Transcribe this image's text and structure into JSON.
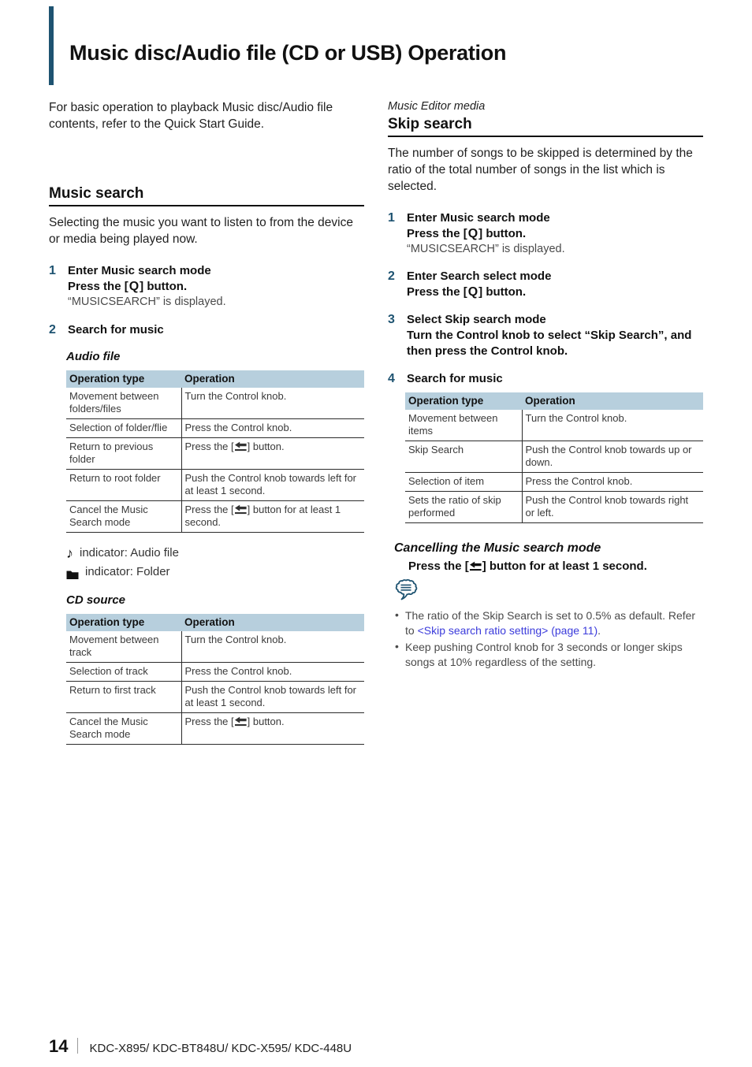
{
  "page": {
    "title": "Music disc/Audio file (CD or USB) Operation",
    "footer_page_number": "14",
    "footer_models": "KDC-X895/ KDC-BT848U/ KDC-X595/ KDC-448U"
  },
  "colors": {
    "accent_rule": "#1e5371",
    "step_number": "#1e5371",
    "table_header_bg": "#b7cfdd",
    "xref_link": "#3b3bdb"
  },
  "left_column": {
    "intro": "For basic operation to playback Music disc/Audio file contents, refer to the Quick Start Guide.",
    "section_heading": "Music search",
    "section_intro": "Selecting the music you want to listen to from the device or media being played now.",
    "steps": [
      {
        "number": "1",
        "title": "Enter Music search mode",
        "action_prefix": "Press the [",
        "action_key": "Q",
        "action_suffix": "] button.",
        "note": "“MUSICSEARCH” is displayed."
      },
      {
        "number": "2",
        "title": "Search for music"
      }
    ],
    "audio_file": {
      "heading": "Audio file",
      "columns": [
        "Operation type",
        "Operation"
      ],
      "rows": [
        [
          "Movement between folders/files",
          "Turn the Control knob."
        ],
        [
          "Selection of folder/flie",
          "Press the Control knob."
        ],
        [
          "Return to previous folder",
          "Press the [↩] button."
        ],
        [
          "Return to root folder",
          "Push the Control knob towards left for at least 1 second."
        ],
        [
          "Cancel the Music Search mode",
          "Press the [↩] button for at least 1 second."
        ]
      ],
      "rows_display": [
        {
          "type": "Movement between folders/files",
          "op_pre": "Turn the Control knob.",
          "op_icon": false,
          "op_post": ""
        },
        {
          "type": "Selection of folder/flie",
          "op_pre": "Press the Control knob.",
          "op_icon": false,
          "op_post": ""
        },
        {
          "type": "Return to previous folder",
          "op_pre": "Press the [",
          "op_icon": true,
          "op_post": "] button."
        },
        {
          "type": "Return to root folder",
          "op_pre": "Push the Control knob towards left for at least 1 second.",
          "op_icon": false,
          "op_post": ""
        },
        {
          "type": "Cancel the Music Search mode",
          "op_pre": "Press the [",
          "op_icon": true,
          "op_post": "] button for at least 1 second."
        }
      ]
    },
    "indicators": [
      {
        "icon": "music-note-icon",
        "label": "indicator: Audio file"
      },
      {
        "icon": "folder-icon",
        "label": "indicator: Folder"
      }
    ],
    "cd_source": {
      "heading": "CD source",
      "columns": [
        "Operation type",
        "Operation"
      ],
      "rows_display": [
        {
          "type": "Movement between track",
          "op_pre": "Turn the Control knob.",
          "op_icon": false,
          "op_post": ""
        },
        {
          "type": "Selection of track",
          "op_pre": "Press the Control knob.",
          "op_icon": false,
          "op_post": ""
        },
        {
          "type": "Return to first track",
          "op_pre": "Push the Control knob towards left for at least 1 second.",
          "op_icon": false,
          "op_post": ""
        },
        {
          "type": "Cancel the Music Search mode",
          "op_pre": "Press the [",
          "op_icon": true,
          "op_post": "] button."
        }
      ]
    }
  },
  "right_column": {
    "kicker": "Music Editor media",
    "section_heading": "Skip search",
    "section_intro": "The number of songs to be skipped is determined by the ratio of the total number of songs in the list which is selected.",
    "steps": [
      {
        "number": "1",
        "title": "Enter Music search mode",
        "action_prefix": "Press the [",
        "action_key": "Q",
        "action_suffix": "] button.",
        "note": "“MUSICSEARCH” is displayed."
      },
      {
        "number": "2",
        "title": "Enter Search select mode",
        "action_prefix": "Press the [",
        "action_key": "Q",
        "action_suffix": "] button."
      },
      {
        "number": "3",
        "title": "Select Skip search mode",
        "action_plain": "Turn the Control knob to select “Skip Search”, and then press the Control knob."
      },
      {
        "number": "4",
        "title": "Search for music"
      }
    ],
    "skip_table": {
      "columns": [
        "Operation type",
        "Operation"
      ],
      "rows_display": [
        {
          "type": "Movement between items",
          "op": "Turn the Control knob."
        },
        {
          "type": "Skip Search",
          "op": "Push the Control knob towards up or down."
        },
        {
          "type": "Selection of item",
          "op": "Press the Control knob."
        },
        {
          "type": "Sets the ratio of skip performed",
          "op": "Push the Control knob towards right or left."
        }
      ]
    },
    "cancelling": {
      "heading": "Cancelling the Music search mode",
      "action_prefix": "Press the [",
      "action_suffix": "] button for at least 1 second."
    },
    "tips": {
      "icon": "note-bubble-icon",
      "items": [
        {
          "text_before": "The ratio of the Skip Search is set to 0.5% as default. Refer to ",
          "link": "<Skip search ratio setting> (page 11)",
          "text_after": "."
        },
        {
          "text_before": "Keep pushing Control knob for 3 seconds or longer skips songs at 10% regardless of the setting.",
          "link": "",
          "text_after": ""
        }
      ]
    }
  }
}
